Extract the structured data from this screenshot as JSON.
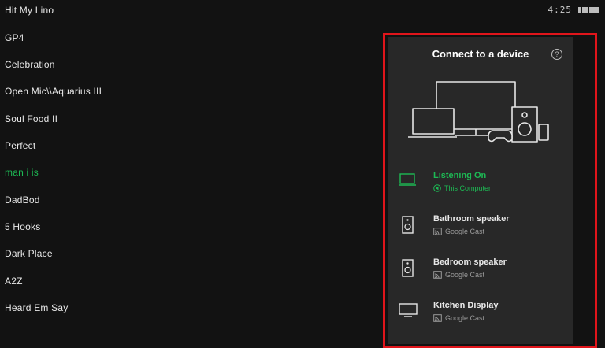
{
  "status": {
    "time": "4:25"
  },
  "tracks": [
    {
      "title": "Hit My Lino",
      "active": false
    },
    {
      "title": "GP4",
      "active": false
    },
    {
      "title": "Celebration",
      "active": false
    },
    {
      "title": "Open Mic\\\\Aquarius III",
      "active": false
    },
    {
      "title": "Soul Food II",
      "active": false
    },
    {
      "title": "Perfect",
      "active": false
    },
    {
      "title": "man i is",
      "active": true
    },
    {
      "title": "DadBod",
      "active": false
    },
    {
      "title": "5 Hooks",
      "active": false
    },
    {
      "title": "Dark Place",
      "active": false
    },
    {
      "title": "A2Z",
      "active": false
    },
    {
      "title": "Heard Em Say",
      "active": false
    }
  ],
  "connect_panel": {
    "title": "Connect to a device",
    "help_icon": "?",
    "devices": [
      {
        "name": "Listening On",
        "sub": "This Computer",
        "icon": "laptop-icon",
        "sub_icon": "speaker-wave-icon",
        "active": true
      },
      {
        "name": "Bathroom speaker",
        "sub": "Google Cast",
        "icon": "speaker-icon",
        "sub_icon": "cast-icon",
        "active": false
      },
      {
        "name": "Bedroom speaker",
        "sub": "Google Cast",
        "icon": "speaker-icon",
        "sub_icon": "cast-icon",
        "active": false
      },
      {
        "name": "Kitchen Display",
        "sub": "Google Cast",
        "icon": "monitor-icon",
        "sub_icon": "cast-icon",
        "active": false
      }
    ]
  },
  "colors": {
    "accent": "#1db954",
    "highlight_frame": "#e0151b",
    "panel": "#282828",
    "background": "#121212"
  }
}
